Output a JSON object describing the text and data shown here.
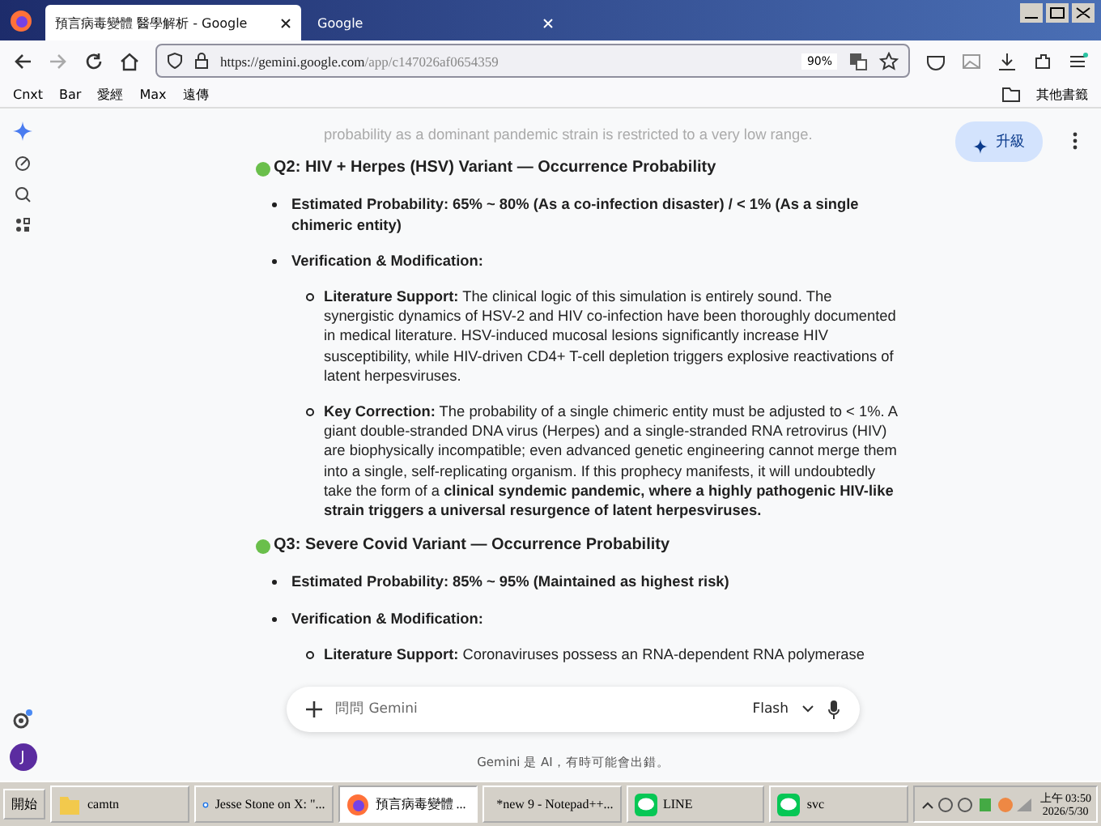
{
  "browser": {
    "tabs": [
      {
        "title": "預言病毒變體 醫學解析 - Google",
        "selected": true
      },
      {
        "title": "Google",
        "selected": false
      }
    ],
    "url_host": "https://gemini.google.com",
    "url_path": "/app/c147026af0654359",
    "zoom": "90%",
    "bookmarks": [
      "Cnxt",
      "Bar",
      "愛經",
      "Max",
      "遠傳"
    ],
    "other_bookmarks": "其他書籤"
  },
  "gemini": {
    "upgrade": "升級",
    "faded_text": "probability as a dominant pandemic strain is restricted to a very low range.",
    "sections": [
      {
        "heading": "Q2: HIV + Herpes (HSV) Variant — Occurrence Probability",
        "bullets": [
          {
            "text": "Estimated Probability: 65% ~ 80% (As a co-infection disaster) / < 1% (As a single chimeric entity)"
          },
          {
            "text": "Verification & Modification:",
            "children": [
              "**Literature Support:** The clinical logic of this simulation is entirely sound. The synergistic dynamics of HSV-2 and HIV co-infection have been thoroughly documented in medical literature. HSV-induced mucosal lesions significantly increase HIV susceptibility, while HIV-driven CD4+ T-cell depletion triggers explosive reactivations of latent herpesviruses.",
              "**Key Correction:** The probability of a single chimeric entity must be adjusted to < 1%. A giant double-stranded DNA virus (Herpes) and a single-stranded RNA retrovirus (HIV) are biophysically incompatible; even advanced genetic engineering cannot merge them into a single, self-replicating organism. If this prophecy manifests, it will undoubtedly take the form of a **clinical syndemic pandemic, where a highly pathogenic HIV-like strain triggers a universal resurgence of latent herpesviruses.**"
            ]
          }
        ]
      },
      {
        "heading": "Q3: Severe Covid Variant — Occurrence Probability",
        "bullets": [
          {
            "text": "Estimated Probability: 85% ~ 95% (Maintained as highest risk)"
          },
          {
            "text": "Verification & Modification:",
            "children": [
              "**Literature Support:** Coronaviruses possess an RNA-dependent RNA polymerase"
            ]
          }
        ]
      }
    ],
    "input": {
      "placeholder": "問問 Gemini",
      "model": "Flash"
    },
    "disclaimer": "Gemini 是 AI，有時可能會出錯。",
    "avatar": "J"
  },
  "taskbar": {
    "start": "開始",
    "items": [
      {
        "label": "camtn",
        "kind": "folder",
        "selected": false
      },
      {
        "label": "Jesse Stone on X: \"...",
        "kind": "browser",
        "selected": false
      },
      {
        "label": "預言病毒變體 ...",
        "kind": "firefox",
        "selected": true
      },
      {
        "label": "*new 9 - Notepad++...",
        "kind": "notepad",
        "selected": false
      },
      {
        "label": "LINE",
        "kind": "line",
        "selected": false
      },
      {
        "label": "svc",
        "kind": "line",
        "selected": false
      }
    ],
    "time": "上午 03:50",
    "date": "2026/5/30"
  }
}
